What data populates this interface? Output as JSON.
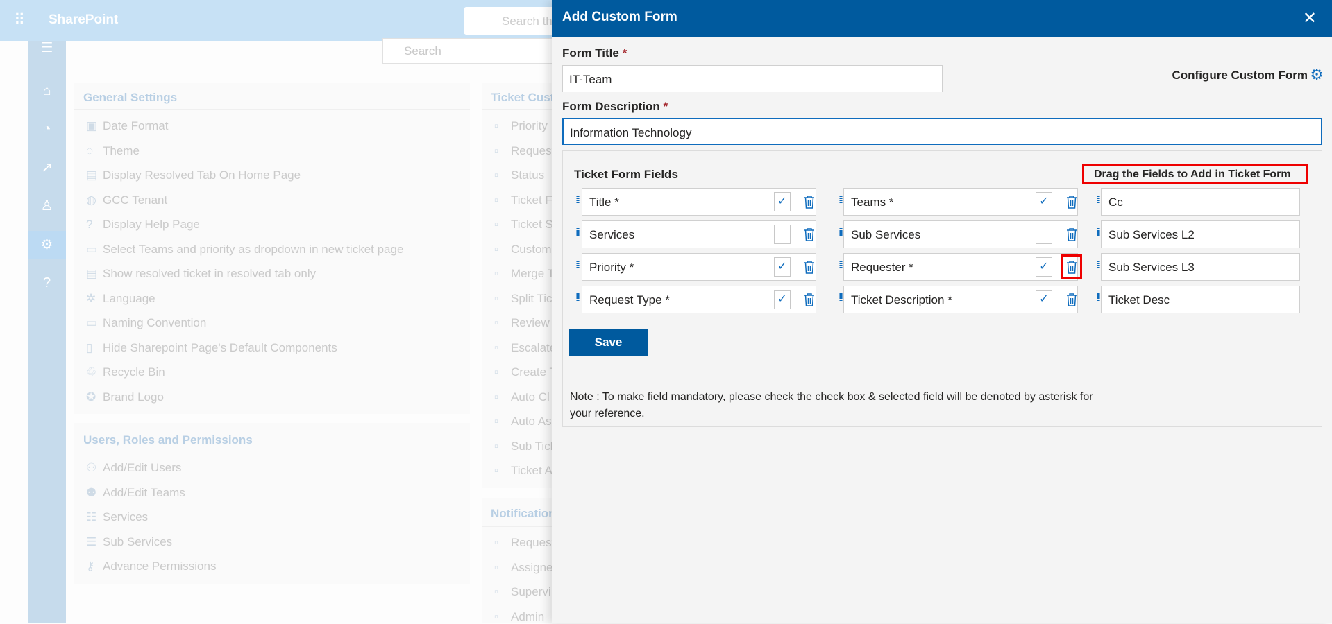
{
  "topbar": {
    "app_name": "SharePoint",
    "search_placeholder": "Search th"
  },
  "background": {
    "search_placeholder": "Search",
    "general": {
      "title": "General Settings",
      "items": [
        {
          "icon": "calendar-icon",
          "label": "Date Format"
        },
        {
          "icon": "palette-icon",
          "label": "Theme"
        },
        {
          "icon": "document-icon",
          "label": "Display Resolved Tab On Home Page"
        },
        {
          "icon": "globe-icon",
          "label": "GCC Tenant"
        },
        {
          "icon": "question-icon",
          "label": "Display Help Page"
        },
        {
          "icon": "dropdown-icon",
          "label": "Select Teams and priority as dropdown in new ticket page"
        },
        {
          "icon": "document-icon",
          "label": "Show resolved ticket in resolved tab only"
        },
        {
          "icon": "translate-icon",
          "label": "Language"
        },
        {
          "icon": "rename-icon",
          "label": "Naming Convention"
        },
        {
          "icon": "page-icon",
          "label": "Hide Sharepoint Page's Default Components"
        },
        {
          "icon": "recycle-bin-icon",
          "label": "Recycle Bin"
        },
        {
          "icon": "badge-icon",
          "label": "Brand Logo"
        }
      ]
    },
    "users": {
      "title": "Users, Roles and Permissions",
      "items": [
        {
          "icon": "users-icon",
          "label": "Add/Edit Users"
        },
        {
          "icon": "teams-icon",
          "label": "Add/Edit Teams"
        },
        {
          "icon": "list-icon",
          "label": "Services"
        },
        {
          "icon": "sublist-icon",
          "label": "Sub Services"
        },
        {
          "icon": "key-icon",
          "label": "Advance Permissions"
        }
      ]
    },
    "ticket": {
      "title": "Ticket Cust",
      "items": [
        "Priority",
        "Request",
        "Status",
        "Ticket F",
        "Ticket S",
        "Custom",
        "Merge T",
        "Split Tic",
        "Review",
        "Escalate",
        "Create T",
        "Auto Cl",
        "Auto As",
        "Sub Tick",
        "Ticket A"
      ]
    },
    "notifications": {
      "title": "Notification",
      "items": [
        "Request",
        "Assigne",
        "Supervi",
        "Admin"
      ]
    }
  },
  "panel": {
    "title": "Add Custom Form",
    "form_title_label": "Form Title",
    "form_title_value": "IT-Team",
    "form_description_label": "Form Description",
    "form_description_value": "Information Technology",
    "required_mark": "*",
    "configure_label": "Configure Custom Form",
    "ticket_form_fields_label": "Ticket Form Fields",
    "drag_label": "Drag the Fields to Add in Ticket Form",
    "fields_col1": [
      {
        "label": "Title *",
        "checked": true
      },
      {
        "label": "Services",
        "checked": false
      },
      {
        "label": "Priority *",
        "checked": true
      },
      {
        "label": "Request Type *",
        "checked": true
      }
    ],
    "fields_col2": [
      {
        "label": "Teams *",
        "checked": true
      },
      {
        "label": "Sub Services",
        "checked": false
      },
      {
        "label": "Requester *",
        "checked": true
      },
      {
        "label": "Ticket Description *",
        "checked": true
      }
    ],
    "available_fields": [
      "Cc",
      "Sub Services L2",
      "Sub Services L3",
      "Ticket Desc"
    ],
    "save_label": "Save",
    "note": "Note : To make field mandatory, please check the check box & selected field will be denoted by asterisk for your reference.",
    "highlight_color": "#e00000",
    "accent_color": "#005a9e"
  }
}
